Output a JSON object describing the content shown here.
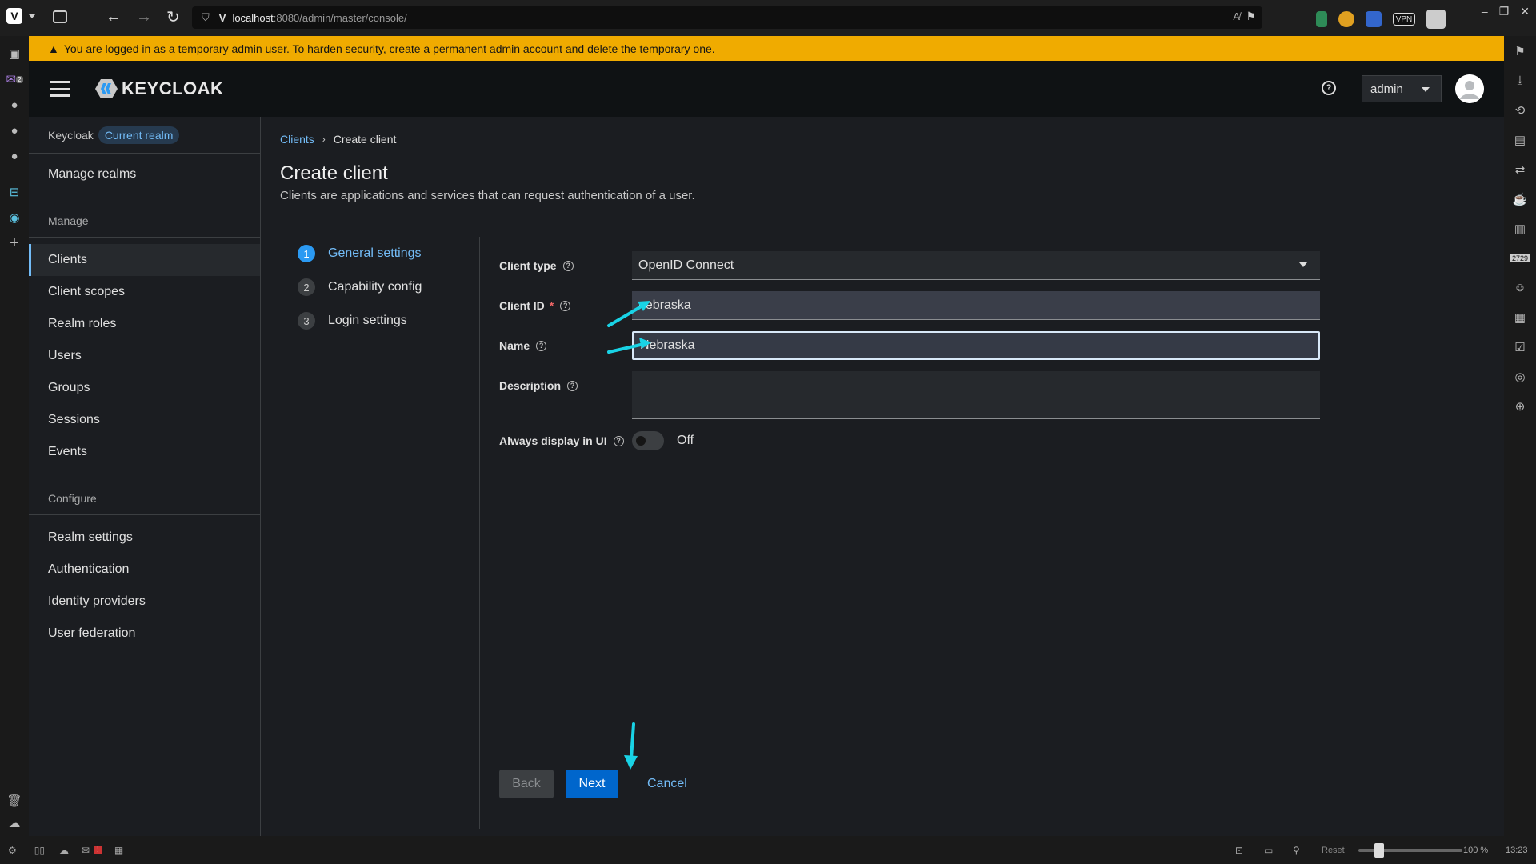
{
  "browser": {
    "url_host": "localhost",
    "url_path": ":8080/admin/master/console/",
    "zoom_reset": "Reset",
    "zoom_level": "100 %",
    "clock": "13:23",
    "vpn_label": "VPN",
    "mail_badge": "2",
    "panel_badge": "2729"
  },
  "warning": {
    "text": "You are logged in as a temporary admin user. To harden security, create a permanent admin account and delete the temporary one."
  },
  "masthead": {
    "logo_text": "KEYCLOAK",
    "user_label": "admin"
  },
  "sidebar": {
    "realm_name": "Keycloak",
    "realm_badge": "Current realm",
    "manage_realms": "Manage realms",
    "manage_section": "Manage",
    "manage_items": [
      "Clients",
      "Client scopes",
      "Realm roles",
      "Users",
      "Groups",
      "Sessions",
      "Events"
    ],
    "configure_section": "Configure",
    "configure_items": [
      "Realm settings",
      "Authentication",
      "Identity providers",
      "User federation"
    ]
  },
  "main": {
    "breadcrumb_link": "Clients",
    "breadcrumb_current": "Create client",
    "title": "Create client",
    "description": "Clients are applications and services that can request authentication of a user."
  },
  "wizard": {
    "steps": [
      {
        "num": "1",
        "label": "General settings"
      },
      {
        "num": "2",
        "label": "Capability config"
      },
      {
        "num": "3",
        "label": "Login settings"
      }
    ]
  },
  "form": {
    "client_type_label": "Client type",
    "client_type_value": "OpenID Connect",
    "client_id_label": "Client ID",
    "client_id_required": "*",
    "client_id_value": "nebraska",
    "name_label": "Name",
    "name_value": "Nebraska",
    "description_label": "Description",
    "description_value": "",
    "always_display_label": "Always display in UI",
    "always_display_value": "Off"
  },
  "buttons": {
    "back": "Back",
    "next": "Next",
    "cancel": "Cancel"
  },
  "colors": {
    "warning": "#f0ab00",
    "link": "#73bcf7",
    "primary": "#0066cc",
    "annotation_arrow": "#19d3e6"
  }
}
